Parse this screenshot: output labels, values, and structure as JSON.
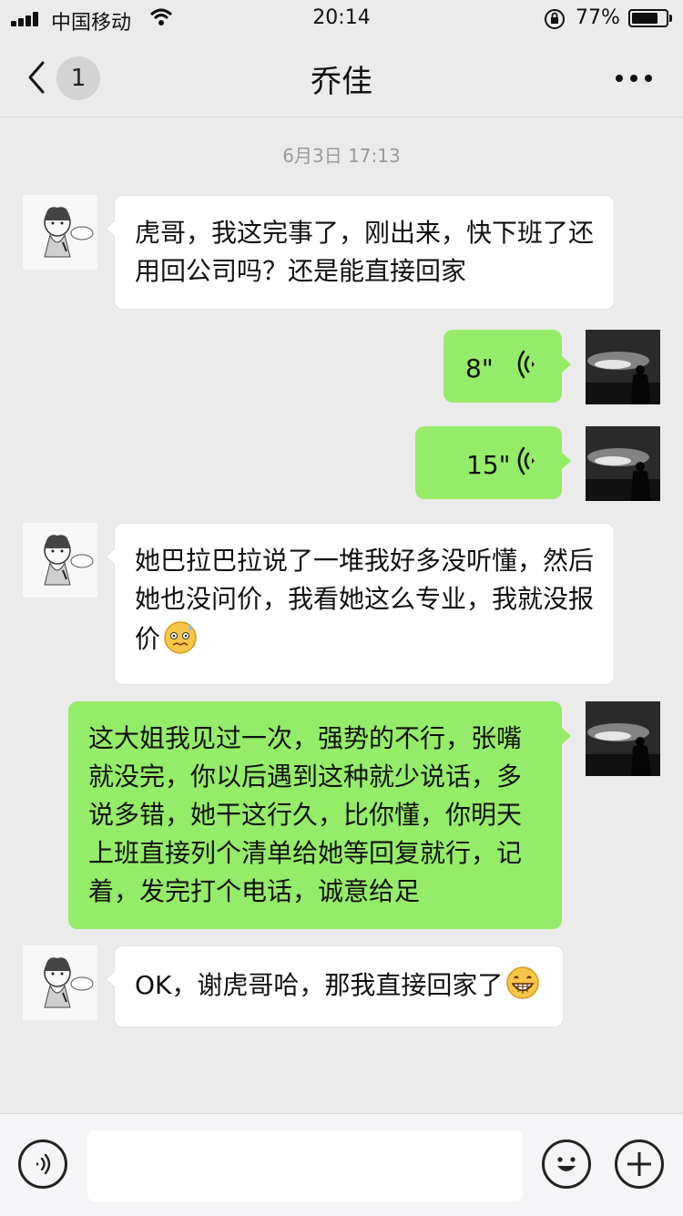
{
  "status_bar": {
    "carrier": "中国移动",
    "time": "20:14",
    "battery_percent_label": "77%",
    "battery_level": 0.77,
    "icons": [
      "signal-icon",
      "wifi-icon",
      "rotation-lock-icon",
      "battery-icon"
    ]
  },
  "header": {
    "title": "乔佳",
    "unread_count": "1",
    "back_icon": "chevron-left-icon",
    "more_icon": "more-dots-icon"
  },
  "chat": {
    "timestamp": "6月3日 17:13",
    "messages": [
      {
        "sender": "contact",
        "type": "text",
        "lines": [
          "虎哥，我这完事了，刚出来，快下班了还",
          "用回公司吗？还是能直接回家"
        ]
      },
      {
        "sender": "me",
        "type": "voice",
        "duration": "8\""
      },
      {
        "sender": "me",
        "type": "voice",
        "duration": "15\""
      },
      {
        "sender": "contact",
        "type": "text",
        "lines": [
          "她巴拉巴拉说了一堆我好多没听懂，然后",
          "她也没问价，我看她这么专业，我就没报",
          "价"
        ],
        "emoji": "awkward-sweat-emoji"
      },
      {
        "sender": "me",
        "type": "text",
        "lines": [
          "这大姐我见过一次，强势的不行，张嘴",
          "就没完，你以后遇到这种就少说话，多",
          "说多错，她干这行久，比你懂，你明天",
          "上班直接列个清单给她等回复就行，记",
          "着，发完打个电话，诚意给足"
        ]
      },
      {
        "sender": "contact",
        "type": "text",
        "lines": [
          "OK，谢虎哥哈，那我直接回家了"
        ],
        "emoji": "grin-emoji"
      }
    ]
  },
  "input_bar": {
    "voice_icon": "voice-mode-icon",
    "emoji_icon": "emoji-icon",
    "plus_icon": "plus-icon",
    "input_value": ""
  },
  "colors": {
    "background": "#ebebeb",
    "outgoing_bubble": "#95ec69",
    "incoming_bubble": "#ffffff",
    "timestamp_text": "#9a9a9a"
  }
}
